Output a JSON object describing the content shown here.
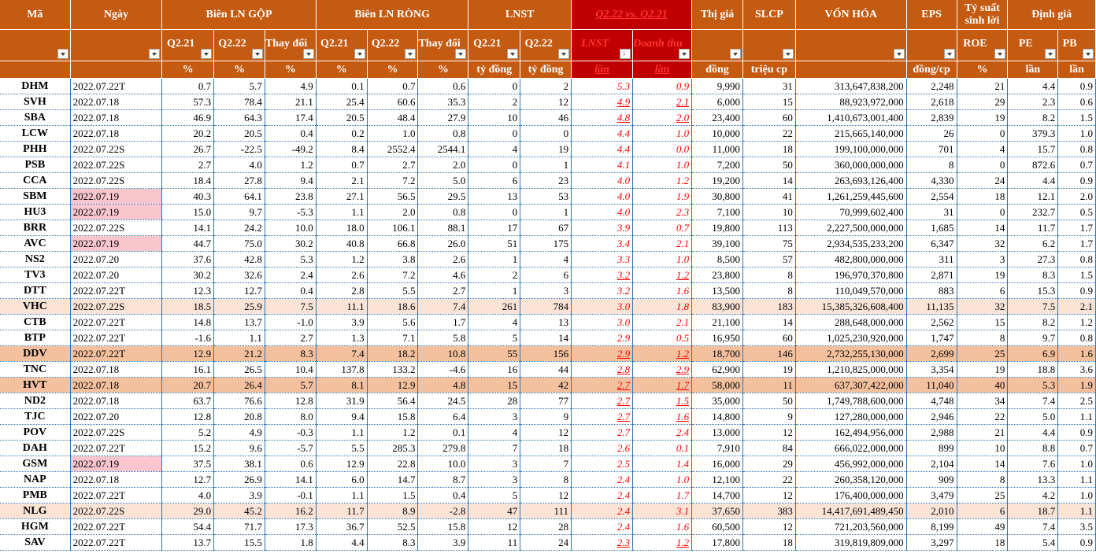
{
  "header": {
    "row1": [
      "Mã",
      "Ngày",
      "Biên LN GỘP",
      "Biên LN RÒNG",
      "LNST",
      "Q2.22 vs. Q2.21",
      "Thị giá",
      "SLCP",
      "VỐN HÓA",
      "EPS",
      "Tỷ suất sinh lời",
      "Định giá"
    ],
    "row2": [
      "Q2.21",
      "Q2.22",
      "Thay đổi",
      "Q2.21",
      "Q2.22",
      "Thay đổi",
      "Q2.21",
      "Q2.22",
      "LNST",
      "Doanh thu",
      "ROE",
      "PE",
      "PB"
    ],
    "row3": [
      "%",
      "%",
      "%",
      "%",
      "%",
      "%",
      "tỷ đồng",
      "tỷ đồng",
      "lần",
      "lần",
      "đồng",
      "triệu cp",
      "đồng/cp",
      "%",
      "lần",
      "lần"
    ]
  },
  "colors": {
    "header_bg": "#c55a11",
    "header_red_bg": "#c00000",
    "highlight_light": "#fbe4d6",
    "highlight_dark": "#f4c09e",
    "date_pink": "#f8c6cc",
    "ratio_text": "#ff0000"
  },
  "rows": [
    {
      "ma": "DHM",
      "ngay": "2022.07.22T",
      "g21": "0.7",
      "g22": "5.7",
      "gtd": "4.9",
      "r21": "0.1",
      "r22": "0.7",
      "rtd": "0.6",
      "l21": "0",
      "l22": "2",
      "xl": "5.3",
      "xd": "0.9",
      "gia": "9,990",
      "slcp": "31",
      "von": "313,647,838,200",
      "eps": "2,248",
      "roe": "21",
      "pe": "4.4",
      "pb": "0.9"
    },
    {
      "ma": "SVH",
      "ngay": "2022.07.18",
      "g21": "57.3",
      "g22": "78.4",
      "gtd": "21.1",
      "r21": "25.4",
      "r22": "60.6",
      "rtd": "35.3",
      "l21": "2",
      "l22": "12",
      "xl": "4.9",
      "xd": "2.1",
      "gia": "6,000",
      "slcp": "15",
      "von": "88,923,972,000",
      "eps": "2,618",
      "roe": "29",
      "pe": "2.3",
      "pb": "0.6"
    },
    {
      "ma": "SBA",
      "ngay": "2022.07.18",
      "g21": "46.9",
      "g22": "64.3",
      "gtd": "17.4",
      "r21": "20.5",
      "r22": "48.4",
      "rtd": "27.9",
      "l21": "10",
      "l22": "46",
      "xl": "4.8",
      "xd": "2.0",
      "gia": "23,400",
      "slcp": "60",
      "von": "1,410,673,001,400",
      "eps": "2,839",
      "roe": "19",
      "pe": "8.2",
      "pb": "1.5"
    },
    {
      "ma": "LCW",
      "ngay": "2022.07.18",
      "g21": "20.2",
      "g22": "20.5",
      "gtd": "0.4",
      "r21": "0.2",
      "r22": "1.0",
      "rtd": "0.8",
      "l21": "0",
      "l22": "0",
      "xl": "4.4",
      "xd": "1.0",
      "gia": "10,000",
      "slcp": "22",
      "von": "215,665,140,000",
      "eps": "26",
      "roe": "0",
      "pe": "379.3",
      "pb": "1.0"
    },
    {
      "ma": "PHH",
      "ngay": "2022.07.22S",
      "g21": "26.7",
      "g22": "-22.5",
      "gtd": "-49.2",
      "r21": "8.4",
      "r22": "2552.4",
      "rtd": "2544.1",
      "l21": "4",
      "l22": "19",
      "xl": "4.4",
      "xd": "0.0",
      "gia": "11,000",
      "slcp": "18",
      "von": "199,100,000,000",
      "eps": "701",
      "roe": "4",
      "pe": "15.7",
      "pb": "0.8"
    },
    {
      "ma": "PSB",
      "ngay": "2022.07.22S",
      "g21": "2.7",
      "g22": "4.0",
      "gtd": "1.2",
      "r21": "0.7",
      "r22": "2.7",
      "rtd": "2.0",
      "l21": "0",
      "l22": "1",
      "xl": "4.1",
      "xd": "1.0",
      "gia": "7,200",
      "slcp": "50",
      "von": "360,000,000,000",
      "eps": "8",
      "roe": "0",
      "pe": "872.6",
      "pb": "0.7"
    },
    {
      "ma": "CCA",
      "ngay": "2022.07.22S",
      "g21": "18.4",
      "g22": "27.8",
      "gtd": "9.4",
      "r21": "2.1",
      "r22": "7.2",
      "rtd": "5.0",
      "l21": "6",
      "l22": "23",
      "xl": "4.0",
      "xd": "1.2",
      "gia": "19,200",
      "slcp": "14",
      "von": "263,693,126,400",
      "eps": "4,330",
      "roe": "24",
      "pe": "4.4",
      "pb": "0.9"
    },
    {
      "ma": "SBM",
      "ngay": "2022.07.19",
      "g21": "40.3",
      "g22": "64.1",
      "gtd": "23.8",
      "r21": "27.1",
      "r22": "56.5",
      "rtd": "29.5",
      "l21": "13",
      "l22": "53",
      "xl": "4.0",
      "xd": "1.9",
      "gia": "30,800",
      "slcp": "41",
      "von": "1,261,259,445,600",
      "eps": "2,554",
      "roe": "18",
      "pe": "12.1",
      "pb": "2.0"
    },
    {
      "ma": "HU3",
      "ngay": "2022.07.19",
      "g21": "15.0",
      "g22": "9.7",
      "gtd": "-5.3",
      "r21": "1.1",
      "r22": "2.0",
      "rtd": "0.8",
      "l21": "0",
      "l22": "1",
      "xl": "4.0",
      "xd": "2.3",
      "gia": "7,100",
      "slcp": "10",
      "von": "70,999,602,400",
      "eps": "31",
      "roe": "0",
      "pe": "232.7",
      "pb": "0.5"
    },
    {
      "ma": "BRR",
      "ngay": "2022.07.22S",
      "g21": "14.1",
      "g22": "24.2",
      "gtd": "10.0",
      "r21": "18.0",
      "r22": "106.1",
      "rtd": "88.1",
      "l21": "17",
      "l22": "67",
      "xl": "3.9",
      "xd": "0.7",
      "gia": "19,800",
      "slcp": "113",
      "von": "2,227,500,000,000",
      "eps": "1,685",
      "roe": "14",
      "pe": "11.7",
      "pb": "1.7"
    },
    {
      "ma": "AVC",
      "ngay": "2022.07.19",
      "g21": "44.7",
      "g22": "75.0",
      "gtd": "30.2",
      "r21": "40.8",
      "r22": "66.8",
      "rtd": "26.0",
      "l21": "51",
      "l22": "175",
      "xl": "3.4",
      "xd": "2.1",
      "gia": "39,100",
      "slcp": "75",
      "von": "2,934,535,233,200",
      "eps": "6,347",
      "roe": "32",
      "pe": "6.2",
      "pb": "1.7"
    },
    {
      "ma": "NS2",
      "ngay": "2022.07.20",
      "g21": "37.6",
      "g22": "42.8",
      "gtd": "5.3",
      "r21": "1.2",
      "r22": "3.8",
      "rtd": "2.6",
      "l21": "1",
      "l22": "4",
      "xl": "3.3",
      "xd": "1.0",
      "gia": "8,500",
      "slcp": "57",
      "von": "482,800,000,000",
      "eps": "311",
      "roe": "3",
      "pe": "27.3",
      "pb": "0.8"
    },
    {
      "ma": "TV3",
      "ngay": "2022.07.20",
      "g21": "30.2",
      "g22": "32.6",
      "gtd": "2.4",
      "r21": "2.6",
      "r22": "7.2",
      "rtd": "4.6",
      "l21": "2",
      "l22": "6",
      "xl": "3.2",
      "xd": "1.2",
      "gia": "23,800",
      "slcp": "8",
      "von": "196,970,370,800",
      "eps": "2,871",
      "roe": "19",
      "pe": "8.3",
      "pb": "1.5"
    },
    {
      "ma": "DTT",
      "ngay": "2022.07.22T",
      "g21": "12.3",
      "g22": "12.7",
      "gtd": "0.4",
      "r21": "2.8",
      "r22": "5.5",
      "rtd": "2.7",
      "l21": "1",
      "l22": "3",
      "xl": "3.2",
      "xd": "1.6",
      "gia": "13,500",
      "slcp": "8",
      "von": "110,049,570,000",
      "eps": "883",
      "roe": "6",
      "pe": "15.3",
      "pb": "0.9"
    },
    {
      "ma": "VHC",
      "ngay": "2022.07.22S",
      "g21": "18.5",
      "g22": "25.9",
      "gtd": "7.5",
      "r21": "11.1",
      "r22": "18.6",
      "rtd": "7.4",
      "l21": "261",
      "l22": "784",
      "xl": "3.0",
      "xd": "1.8",
      "gia": "83,900",
      "slcp": "183",
      "von": "15,385,326,608,400",
      "eps": "11,135",
      "roe": "32",
      "pe": "7.5",
      "pb": "2.1"
    },
    {
      "ma": "CTB",
      "ngay": "2022.07.22T",
      "g21": "14.8",
      "g22": "13.7",
      "gtd": "-1.0",
      "r21": "3.9",
      "r22": "5.6",
      "rtd": "1.7",
      "l21": "4",
      "l22": "13",
      "xl": "3.0",
      "xd": "2.1",
      "gia": "21,100",
      "slcp": "14",
      "von": "288,648,000,000",
      "eps": "2,562",
      "roe": "15",
      "pe": "8.2",
      "pb": "1.2"
    },
    {
      "ma": "BTP",
      "ngay": "2022.07.22T",
      "g21": "-1.6",
      "g22": "1.1",
      "gtd": "2.7",
      "r21": "1.3",
      "r22": "7.1",
      "rtd": "5.8",
      "l21": "5",
      "l22": "14",
      "xl": "2.9",
      "xd": "0.5",
      "gia": "16,950",
      "slcp": "60",
      "von": "1,025,230,920,000",
      "eps": "1,747",
      "roe": "8",
      "pe": "9.7",
      "pb": "0.8"
    },
    {
      "ma": "DDV",
      "ngay": "2022.07.22T",
      "g21": "12.9",
      "g22": "21.2",
      "gtd": "8.3",
      "r21": "7.4",
      "r22": "18.2",
      "rtd": "10.8",
      "l21": "55",
      "l22": "156",
      "xl": "2.9",
      "xd": "1.2",
      "gia": "18,700",
      "slcp": "146",
      "von": "2,732,255,130,000",
      "eps": "2,699",
      "roe": "25",
      "pe": "6.9",
      "pb": "1.6"
    },
    {
      "ma": "TNC",
      "ngay": "2022.07.18",
      "g21": "16.1",
      "g22": "26.5",
      "gtd": "10.4",
      "r21": "137.8",
      "r22": "133.2",
      "rtd": "-4.6",
      "l21": "16",
      "l22": "44",
      "xl": "2.8",
      "xd": "2.9",
      "gia": "62,900",
      "slcp": "19",
      "von": "1,210,825,000,000",
      "eps": "3,354",
      "roe": "19",
      "pe": "18.8",
      "pb": "3.6"
    },
    {
      "ma": "HVT",
      "ngay": "2022.07.18",
      "g21": "20.7",
      "g22": "26.4",
      "gtd": "5.7",
      "r21": "8.1",
      "r22": "12.9",
      "rtd": "4.8",
      "l21": "15",
      "l22": "42",
      "xl": "2.7",
      "xd": "1.7",
      "gia": "58,000",
      "slcp": "11",
      "von": "637,307,422,000",
      "eps": "11,040",
      "roe": "40",
      "pe": "5.3",
      "pb": "1.9"
    },
    {
      "ma": "ND2",
      "ngay": "2022.07.18",
      "g21": "63.7",
      "g22": "76.6",
      "gtd": "12.8",
      "r21": "31.9",
      "r22": "56.4",
      "rtd": "24.5",
      "l21": "28",
      "l22": "77",
      "xl": "2.7",
      "xd": "1.5",
      "gia": "35,000",
      "slcp": "50",
      "von": "1,749,788,600,000",
      "eps": "4,748",
      "roe": "34",
      "pe": "7.4",
      "pb": "2.5"
    },
    {
      "ma": "TJC",
      "ngay": "2022.07.20",
      "g21": "12.8",
      "g22": "20.8",
      "gtd": "8.0",
      "r21": "9.4",
      "r22": "15.8",
      "rtd": "6.4",
      "l21": "3",
      "l22": "9",
      "xl": "2.7",
      "xd": "1.6",
      "gia": "14,800",
      "slcp": "9",
      "von": "127,280,000,000",
      "eps": "2,946",
      "roe": "22",
      "pe": "5.0",
      "pb": "1.1"
    },
    {
      "ma": "POV",
      "ngay": "2022.07.22S",
      "g21": "5.2",
      "g22": "4.9",
      "gtd": "-0.3",
      "r21": "1.1",
      "r22": "1.2",
      "rtd": "0.1",
      "l21": "4",
      "l22": "12",
      "xl": "2.7",
      "xd": "2.4",
      "gia": "13,000",
      "slcp": "12",
      "von": "162,494,956,000",
      "eps": "2,988",
      "roe": "21",
      "pe": "4.4",
      "pb": "0.9"
    },
    {
      "ma": "DAH",
      "ngay": "2022.07.22T",
      "g21": "15.2",
      "g22": "9.6",
      "gtd": "-5.7",
      "r21": "5.5",
      "r22": "285.3",
      "rtd": "279.8",
      "l21": "7",
      "l22": "18",
      "xl": "2.6",
      "xd": "0.1",
      "gia": "7,910",
      "slcp": "84",
      "von": "666,022,000,000",
      "eps": "899",
      "roe": "10",
      "pe": "8.8",
      "pb": "0.7"
    },
    {
      "ma": "GSM",
      "ngay": "2022.07.19",
      "g21": "37.5",
      "g22": "38.1",
      "gtd": "0.6",
      "r21": "12.9",
      "r22": "22.8",
      "rtd": "10.0",
      "l21": "3",
      "l22": "7",
      "xl": "2.5",
      "xd": "1.4",
      "gia": "16,000",
      "slcp": "29",
      "von": "456,992,000,000",
      "eps": "2,104",
      "roe": "14",
      "pe": "7.6",
      "pb": "1.0"
    },
    {
      "ma": "NAP",
      "ngay": "2022.07.18",
      "g21": "12.7",
      "g22": "26.9",
      "gtd": "14.1",
      "r21": "6.0",
      "r22": "14.7",
      "rtd": "8.7",
      "l21": "3",
      "l22": "8",
      "xl": "2.4",
      "xd": "1.0",
      "gia": "12,100",
      "slcp": "22",
      "von": "260,358,120,000",
      "eps": "909",
      "roe": "8",
      "pe": "13.3",
      "pb": "1.1"
    },
    {
      "ma": "PMB",
      "ngay": "2022.07.22T",
      "g21": "4.0",
      "g22": "3.9",
      "gtd": "-0.1",
      "r21": "1.1",
      "r22": "1.5",
      "rtd": "0.4",
      "l21": "5",
      "l22": "12",
      "xl": "2.4",
      "xd": "1.7",
      "gia": "14,700",
      "slcp": "12",
      "von": "176,400,000,000",
      "eps": "3,479",
      "roe": "25",
      "pe": "4.2",
      "pb": "1.0"
    },
    {
      "ma": "NLG",
      "ngay": "2022.07.22S",
      "g21": "29.0",
      "g22": "45.2",
      "gtd": "16.2",
      "r21": "11.7",
      "r22": "8.9",
      "rtd": "-2.8",
      "l21": "47",
      "l22": "111",
      "xl": "2.4",
      "xd": "3.1",
      "gia": "37,650",
      "slcp": "383",
      "von": "14,417,691,489,450",
      "eps": "2,010",
      "roe": "6",
      "pe": "18.7",
      "pb": "1.1"
    },
    {
      "ma": "HGM",
      "ngay": "2022.07.22T",
      "g21": "54.4",
      "g22": "71.7",
      "gtd": "17.3",
      "r21": "36.7",
      "r22": "52.5",
      "rtd": "15.8",
      "l21": "12",
      "l22": "28",
      "xl": "2.4",
      "xd": "1.6",
      "gia": "60,500",
      "slcp": "12",
      "von": "721,203,560,000",
      "eps": "8,199",
      "roe": "49",
      "pe": "7.4",
      "pb": "3.5"
    },
    {
      "ma": "SAV",
      "ngay": "2022.07.22T",
      "g21": "13.7",
      "g22": "15.5",
      "gtd": "1.8",
      "r21": "4.4",
      "r22": "8.3",
      "rtd": "3.9",
      "l21": "11",
      "l22": "24",
      "xl": "2.3",
      "xd": "1.2",
      "gia": "17,800",
      "slcp": "18",
      "von": "319,819,809,000",
      "eps": "3,297",
      "roe": "18",
      "pe": "5.4",
      "pb": "0.9"
    }
  ]
}
